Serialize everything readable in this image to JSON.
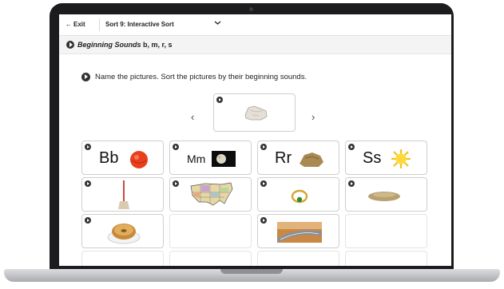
{
  "topbar": {
    "exit_label": "Exit",
    "exit_arrow": "←",
    "sort_title": "Sort 9: Interactive Sort",
    "dropdown_icon": "chevron-down-icon"
  },
  "lesson": {
    "title_italic": "Beginning Sounds",
    "title_letters": "b, m, r, s"
  },
  "instruction": "Name the pictures. Sort the pictures by their beginning sounds.",
  "carousel": {
    "prev": "‹",
    "next": "›",
    "current_picture": "rock"
  },
  "columns": [
    {
      "header": "Bb",
      "header_picture": "ball",
      "pictures": [
        "broom",
        "bagel"
      ]
    },
    {
      "header": "Mm",
      "header_picture": "moon",
      "pictures": [
        "map"
      ]
    },
    {
      "header": "Rr",
      "header_picture": "rock",
      "pictures": [
        "ring",
        "road"
      ]
    },
    {
      "header": "Ss",
      "header_picture": "sun",
      "pictures": [
        "sand"
      ]
    }
  ],
  "colors": {
    "bezel": "#1c1c1e",
    "card_border": "#cfcfcf",
    "play_icon": "#333333"
  }
}
